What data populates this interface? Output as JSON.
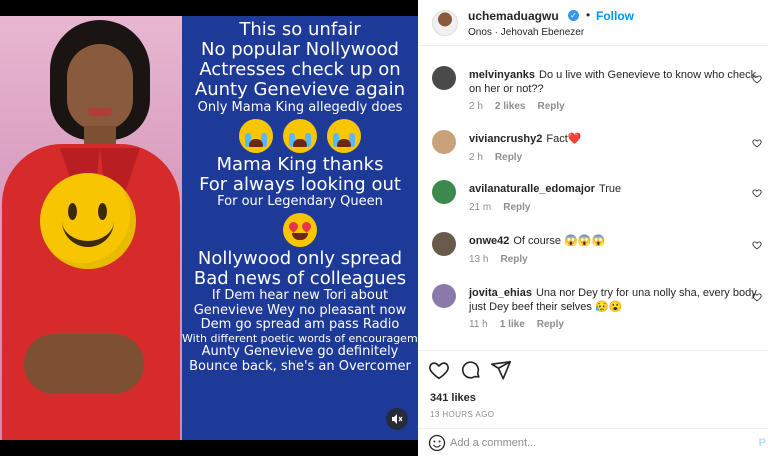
{
  "media": {
    "text_lines": [
      {
        "text": "This so unfair",
        "size": "big"
      },
      {
        "text": "No popular Nollywood",
        "size": "big"
      },
      {
        "text": "Actresses check up on",
        "size": "big"
      },
      {
        "text": "Aunty Genevieve again",
        "size": "big"
      },
      {
        "text": "Only Mama King allegedly does",
        "size": "small"
      }
    ],
    "text_lines_2": [
      {
        "text": "Mama King thanks",
        "size": "big"
      },
      {
        "text": "For always looking out",
        "size": "big"
      },
      {
        "text": "For our Legendary Queen",
        "size": "small"
      }
    ],
    "text_lines_3": [
      {
        "text": "Nollywood only spread",
        "size": "big"
      },
      {
        "text": "Bad news of colleagues",
        "size": "big"
      },
      {
        "text": "If Dem hear new Tori about",
        "size": "small"
      },
      {
        "text": "Genevieve Wey no pleasant now",
        "size": "small"
      },
      {
        "text": "Dem go spread am pass Radio",
        "size": "small"
      },
      {
        "text": "With different poetic words of encouragement",
        "size": "tiny"
      },
      {
        "text": "Aunty Genevieve go definitely",
        "size": "small"
      },
      {
        "text": "Bounce back, she's an Overcomer",
        "size": "small"
      }
    ],
    "mute_icon": "speaker-muted-icon",
    "text_pane_color": "#1e3a98"
  },
  "header": {
    "username": "uchemaduagwu",
    "dot": "•",
    "follow_label": "Follow",
    "subtitle": "Onos · Jehovah Ebenezer",
    "verified_icon": "verified-badge-icon"
  },
  "comments": [
    {
      "username": "melvinyanks",
      "text": "Do u live with Genevieve to know who check on her or not??",
      "time": "2 h",
      "likes": "2 likes",
      "reply": "Reply",
      "avatar_color": "#4a4a4a"
    },
    {
      "username": "viviancrushy2",
      "text": "Fact❤️",
      "time": "2 h",
      "likes": "",
      "reply": "Reply",
      "avatar_color": "#c9a27a"
    },
    {
      "username": "avilanaturalle_edomajor",
      "text": "True",
      "time": "21 m",
      "likes": "",
      "reply": "Reply",
      "avatar_color": "#3d8a4e"
    },
    {
      "username": "onwe42",
      "text": "Of course 😱😱😱",
      "time": "13 h",
      "likes": "",
      "reply": "Reply",
      "avatar_color": "#6a5a4a"
    },
    {
      "username": "jovita_ehias",
      "text": "Una nor Dey try for una nolly sha, every body just Dey beef their selves 😥😮",
      "time": "11 h",
      "likes": "1 like",
      "reply": "Reply",
      "avatar_color": "#8b7aa8"
    }
  ],
  "actions": {
    "like_icon": "heart-icon",
    "comment_icon": "comment-bubble-icon",
    "share_icon": "paper-plane-icon",
    "likes_count": "341 likes",
    "timestamp": "13 HOURS AGO"
  },
  "add_comment": {
    "placeholder": "Add a comment...",
    "post_label": "P",
    "emoji_icon": "smiley-icon"
  }
}
